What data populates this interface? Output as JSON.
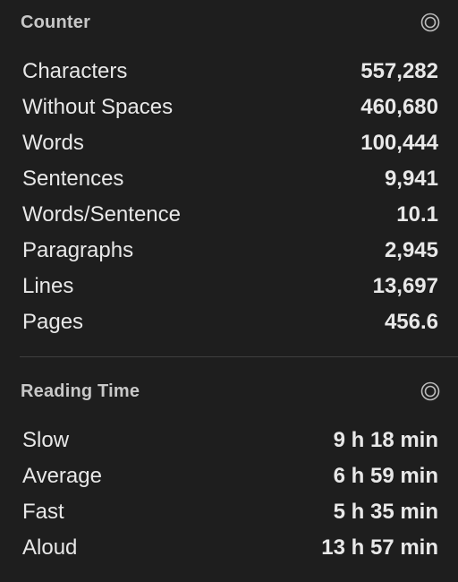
{
  "counter": {
    "title": "Counter",
    "options_icon": "target-circle-icon",
    "rows": [
      {
        "label": "Characters",
        "value": "557,282"
      },
      {
        "label": "Without Spaces",
        "value": "460,680"
      },
      {
        "label": "Words",
        "value": "100,444"
      },
      {
        "label": "Sentences",
        "value": "9,941"
      },
      {
        "label": "Words/Sentence",
        "value": "10.1"
      },
      {
        "label": "Paragraphs",
        "value": "2,945"
      },
      {
        "label": "Lines",
        "value": "13,697"
      },
      {
        "label": "Pages",
        "value": "456.6"
      }
    ]
  },
  "reading_time": {
    "title": "Reading Time",
    "options_icon": "target-circle-icon",
    "rows": [
      {
        "label": "Slow",
        "value": "9 h 18 min"
      },
      {
        "label": "Average",
        "value": "6 h 59 min"
      },
      {
        "label": "Fast",
        "value": "5 h 35 min"
      },
      {
        "label": "Aloud",
        "value": "13 h 57 min"
      }
    ]
  },
  "colors": {
    "background": "#1e1e1e",
    "text": "#e8e8e8",
    "header_text": "#c8c8c8",
    "divider": "#3f3f3f"
  }
}
